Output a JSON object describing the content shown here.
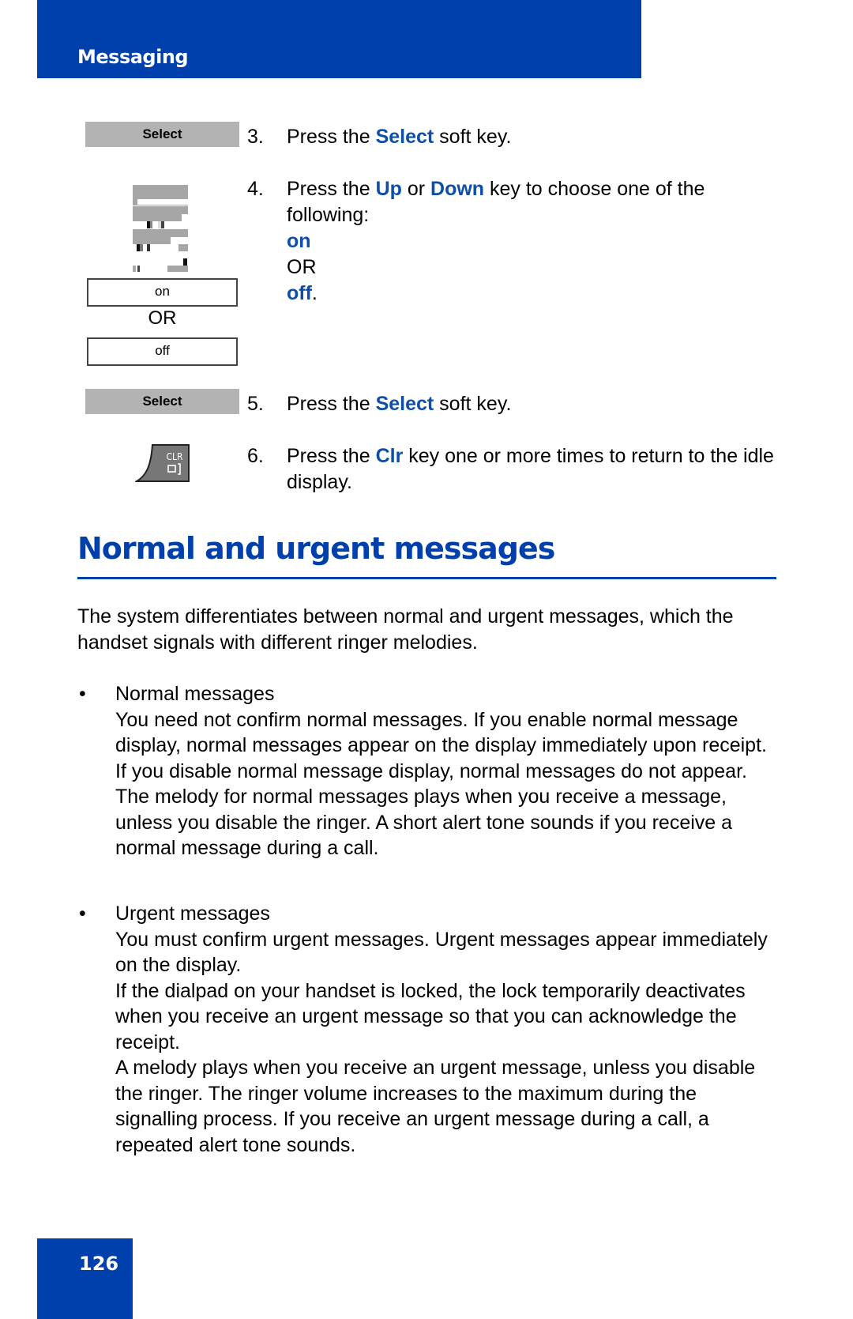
{
  "header": {
    "title": "Messaging"
  },
  "left_column": {
    "softkey_1": "Select",
    "option_on": "on",
    "or_label": "OR",
    "option_off": "off",
    "softkey_2": "Select",
    "icons": [
      "scroll-navigation-icon",
      "clr-key-icon"
    ],
    "clr_key_label": "CLR"
  },
  "steps": [
    {
      "num": "3.",
      "parts": [
        {
          "t": "Press the "
        },
        {
          "t": "Select",
          "hl": true
        },
        {
          "t": " soft key."
        }
      ]
    },
    {
      "num": "4.",
      "parts": [
        {
          "t": "Press the "
        },
        {
          "t": "Up",
          "hl": true
        },
        {
          "t": " or "
        },
        {
          "t": "Down",
          "hl": true
        },
        {
          "t": " key to choose one of the following:"
        }
      ],
      "options": {
        "on": "on",
        "or": "OR",
        "off": "off",
        "end": "."
      }
    },
    {
      "num": "5.",
      "parts": [
        {
          "t": "Press the "
        },
        {
          "t": "Select",
          "hl": true
        },
        {
          "t": " soft key."
        }
      ]
    },
    {
      "num": "6.",
      "parts": [
        {
          "t": "Press the "
        },
        {
          "t": "Clr",
          "hl": true
        },
        {
          "t": " key one or more times to return to the idle display."
        }
      ]
    }
  ],
  "section": {
    "title": "Normal and urgent messages",
    "intro": "The system differentiates between normal and urgent messages, which the handset signals with different ringer melodies.",
    "bullets": [
      {
        "title": "Normal messages",
        "paragraphs": [
          "You need not confirm normal messages. If you enable normal message display, normal messages appear on the display immediately upon receipt. If you disable normal message display, normal messages do not appear.",
          "The melody for normal messages plays when you receive a message, unless you disable the ringer. A short alert tone sounds if you receive a normal message during a call."
        ]
      },
      {
        "title": "Urgent messages",
        "paragraphs": [
          "You must confirm urgent messages. Urgent messages appear immediately on the display.",
          "If the dialpad on your handset is locked, the lock temporarily deactivates when you receive an urgent message so that you can acknowledge the receipt.",
          "A melody plays when you receive an urgent message, unless you disable the ringer. The ringer volume increases to the maximum during the signalling process. If you receive an urgent message during a call, a repeated alert tone sounds."
        ]
      }
    ],
    "bullet_char": "•"
  },
  "footer": {
    "page_number": "126"
  },
  "colors": {
    "brand_blue": "#0040AC",
    "highlight_blue": "#0F4EA8",
    "softkey_gray": "#B3B3B3"
  }
}
